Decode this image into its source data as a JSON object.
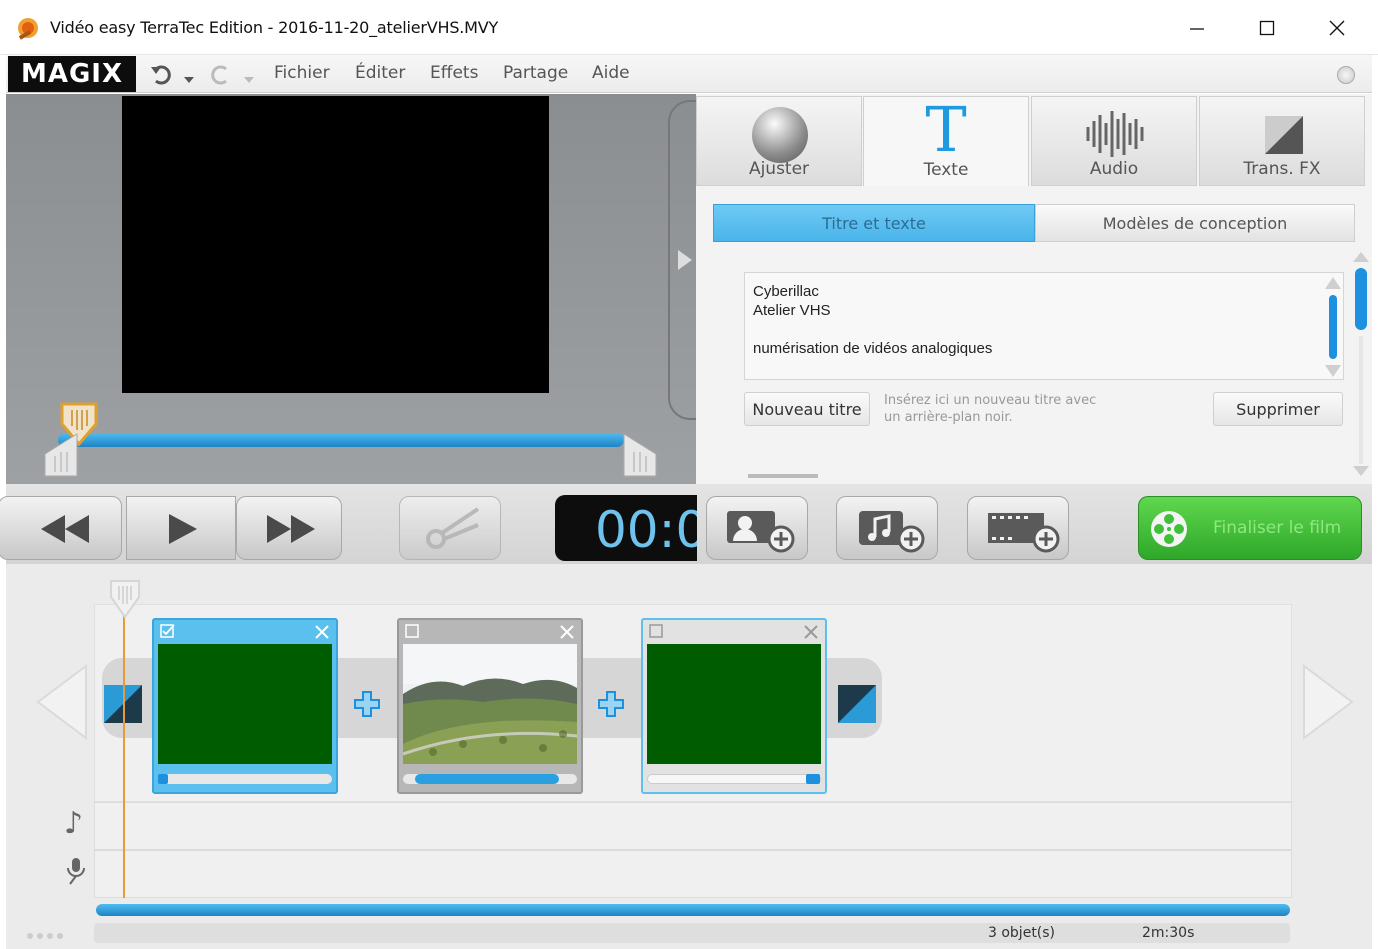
{
  "window": {
    "title": "Vidéo easy TerraTec Edition - 2016-11-20_atelierVHS.MVY"
  },
  "menubar": {
    "logo": "MAGIX",
    "items": [
      "Fichier",
      "Éditer",
      "Effets",
      "Partage",
      "Aide"
    ]
  },
  "tabs": [
    {
      "label": "Ajuster",
      "icon": "sphere-icon"
    },
    {
      "label": "Texte",
      "icon": "text-t-icon"
    },
    {
      "label": "Audio",
      "icon": "waveform-icon"
    },
    {
      "label": "Trans. FX",
      "icon": "transition-icon"
    }
  ],
  "text_panel": {
    "subtab_active": "Titre et texte",
    "subtab_other": "Modèles de conception",
    "text_lines": [
      "Cyberillac",
      "Atelier VHS",
      "",
      "numérisation de vidéos analogiques"
    ],
    "new_title_button": "Nouveau titre",
    "new_title_hint": "Insérez ici un nouveau titre avec un arrière-plan noir.",
    "delete_button": "Supprimer"
  },
  "transport": {
    "timecode": "00:0",
    "finalize_label": "Finaliser le film"
  },
  "timeline": {
    "clips": [
      {
        "name": "clip-1",
        "selected": true,
        "content": "green",
        "progress": 0.05
      },
      {
        "name": "clip-2",
        "selected": false,
        "content": "landscape",
        "progress": 0.85
      },
      {
        "name": "clip-3",
        "selected": false,
        "content": "green",
        "progress": 0.95
      }
    ]
  },
  "status": {
    "objects": "3 objet(s)",
    "duration": "2m:30s"
  },
  "colors": {
    "accent_blue": "#3aa6de",
    "finalize_green": "#3fbf3a",
    "clip_green": "#005c00"
  }
}
